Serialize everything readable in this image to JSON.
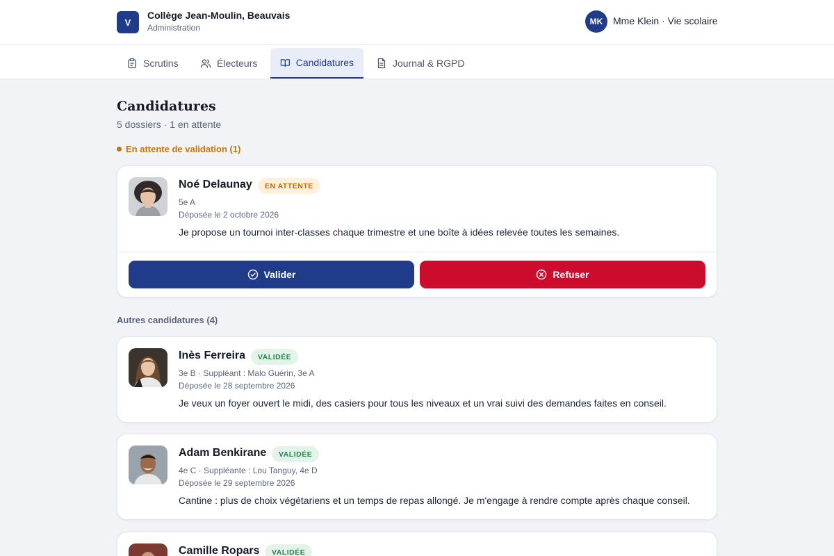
{
  "header": {
    "logo_letter": "V",
    "school_name": "Collège Jean-Moulin, Beauvais",
    "school_sub": "Administration",
    "user_initials": "MK",
    "user_label": "Mme Klein · Vie scolaire"
  },
  "tabs": [
    {
      "label": "Scrutins",
      "icon": "clipboard-icon"
    },
    {
      "label": "Électeurs",
      "icon": "users-icon"
    },
    {
      "label": "Candidatures",
      "icon": "book-open-icon",
      "active": true
    },
    {
      "label": "Journal & RGPD",
      "icon": "document-icon"
    }
  ],
  "page": {
    "title": "Candidatures",
    "subtitle": "5 dossiers · 1 en attente"
  },
  "pending_section": {
    "label": "En attente de validation (1)",
    "color": "#c6740b"
  },
  "pending_candidate": {
    "name": "Noé Delaunay",
    "status": "EN ATTENTE",
    "class_info": "5e A",
    "date": "Déposée le 2 octobre 2026",
    "statement": "Je propose un tournoi inter-classes chaque trimestre et une boîte à idées relevée toutes les semaines.",
    "validate_label": "Valider",
    "refuse_label": "Refuser"
  },
  "others_section": {
    "label": "Autres candidatures (4)"
  },
  "others": [
    {
      "name": "Inès Ferreira",
      "status": "VALIDÉE",
      "class_info": "3e B · Suppléant : Malo Guérin, 3e A",
      "date": "Déposée le 28 septembre 2026",
      "statement": "Je veux un foyer ouvert le midi, des casiers pour tous les niveaux et un vrai suivi des demandes faites en conseil."
    },
    {
      "name": "Adam Benkirane",
      "status": "VALIDÉE",
      "class_info": "4e C · Suppléante : Lou Tanguy, 4e D",
      "date": "Déposée le 29 septembre 2026",
      "statement": "Cantine : plus de choix végétariens et un temps de repas allongé. Je m'engage à rendre compte après chaque conseil."
    },
    {
      "name": "Camille Ropars",
      "status": "VALIDÉE",
      "class_info": "",
      "date": "",
      "statement": ""
    }
  ],
  "colors": {
    "primary": "#1f3b8a",
    "danger": "#cc0c2c",
    "pending": "#c6740b",
    "validated": "#23834a"
  }
}
